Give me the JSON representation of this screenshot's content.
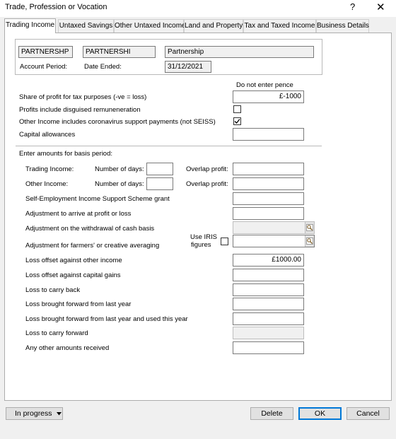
{
  "window": {
    "title": "Trade, Profession or Vocation",
    "help_glyph": "?",
    "close_glyph": "✕"
  },
  "tabs": [
    {
      "label": "Trading Income"
    },
    {
      "label": "Untaxed Savings"
    },
    {
      "label": "Other Untaxed Income"
    },
    {
      "label": "Land and Property"
    },
    {
      "label": "Tax and Taxed Income"
    },
    {
      "label": "Business Details"
    }
  ],
  "header": {
    "code": "PARTNERSHP",
    "short_name": "PARTNERSHI",
    "name": "Partnership",
    "account_period_label": "Account Period:",
    "date_ended_label": "Date Ended:",
    "date_ended_value": "31/12/2021"
  },
  "main": {
    "note": "Do not enter pence",
    "share_profit_label": "Share of profit for tax purposes (-ve = loss)",
    "share_profit_value": "£-1000",
    "disguised_label": "Profits include disguised remuneneration",
    "coronavirus_label": "Other Income includes coronavirus support payments (not SEISS)",
    "capital_allowances_label": "Capital allowances",
    "basis_heading": "Enter amounts for basis period:",
    "trading_income_label": "Trading Income:",
    "other_income_label": "Other Income:",
    "number_of_days_label": "Number of days:",
    "overlap_profit_label": "Overlap profit:",
    "seiss_label": "Self-Employment Income Support Scheme grant",
    "adjust_profit_label": "Adjustment to arrive at profit or loss",
    "adjust_cash_label": "Adjustment on the withdrawal of cash basis",
    "adjust_farmers_label": "Adjustment for farmers' or creative averaging",
    "use_iris_label_1": "Use IRIS",
    "use_iris_label_2": "figures",
    "loss_other_label": "Loss offset against other income",
    "loss_other_value": "£1000.00",
    "loss_capital_label": "Loss offset against capital gains",
    "loss_carry_back_label": "Loss to carry back",
    "loss_bf_label": "Loss brought forward from last year",
    "loss_bf_used_label": "Loss brought forward from last year and used this year",
    "loss_carry_forward_label": "Loss to carry forward",
    "other_amounts_label": "Any other amounts received"
  },
  "footer": {
    "status_label": "In progress",
    "delete_label": "Delete",
    "ok_label": "OK",
    "cancel_label": "Cancel"
  },
  "icons": {
    "lookup": "magnifier-icon",
    "dropdown": "triangle-down-icon",
    "check": "checkmark-icon"
  },
  "colors": {
    "default_button_border": "#0078d7",
    "window_bg": "#f0f0f0"
  }
}
